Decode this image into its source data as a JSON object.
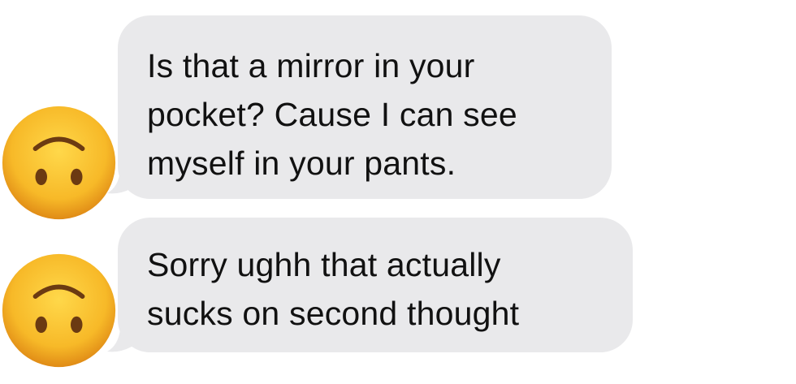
{
  "conversation": {
    "messages": [
      {
        "avatar_icon": "upside-down-face-icon",
        "lines": [
          "Is that a mirror in your",
          "pocket? Cause I can see",
          "myself in your pants."
        ]
      },
      {
        "avatar_icon": "upside-down-face-icon",
        "lines": [
          "Sorry ughh that actually",
          "sucks on second thought"
        ]
      }
    ]
  },
  "colors": {
    "bubble_background": "#e9e9eb",
    "text": "#111111",
    "emoji_face": "#f7b928",
    "emoji_shadow": "#e08b16"
  }
}
